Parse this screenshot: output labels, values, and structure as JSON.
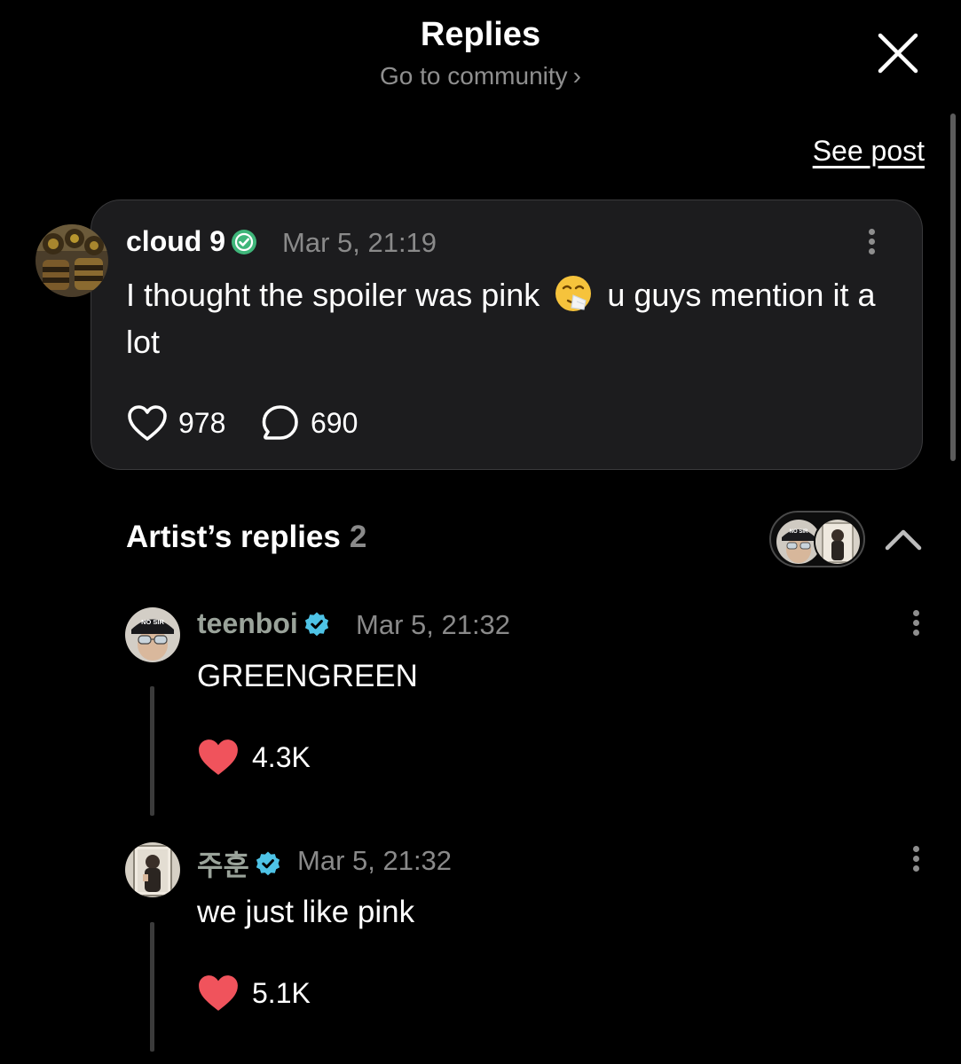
{
  "header": {
    "title": "Replies",
    "subtitle": "Go to community",
    "subtitle_chevron": "›"
  },
  "see_post": "See post",
  "post": {
    "author": "cloud 9",
    "timestamp": "Mar 5, 21:19",
    "text_before_emoji": "I thought the spoiler was pink",
    "emoji": "sneezing-face",
    "text_after_emoji": "u guys mention it a lot",
    "likes": "978",
    "comments": "690",
    "verified_color": "#3fb67a"
  },
  "artist_replies": {
    "title": "Artist’s replies",
    "count": "2"
  },
  "replies": [
    {
      "author": "teenboi",
      "timestamp": "Mar 5, 21:32",
      "text": "GREENGREEN",
      "likes": "4.3K",
      "avatar_cap_text": "NO SIR"
    },
    {
      "author": "주훈",
      "timestamp": "Mar 5, 21:32",
      "text": "we just like pink",
      "likes": "5.1K"
    }
  ],
  "colors": {
    "background": "#000000",
    "card": "#1c1c1e",
    "like_heart": "#f0535c",
    "artist_badge": "#4ec3e6",
    "muted_text": "#8a8a8a"
  }
}
